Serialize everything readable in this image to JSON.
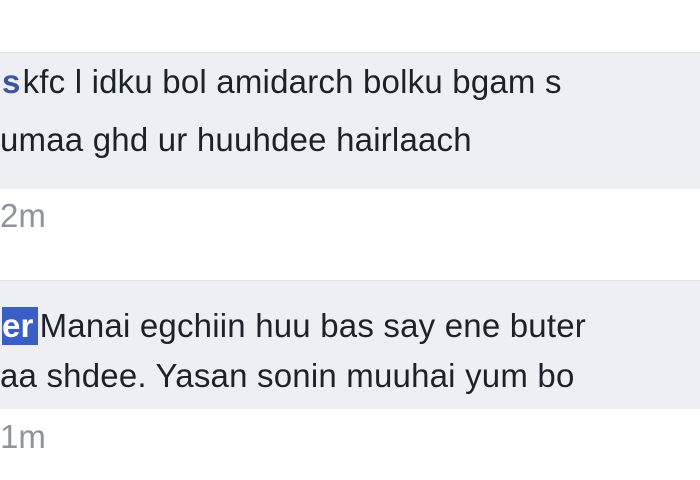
{
  "comments": [
    {
      "name_snippet": "s",
      "line1_rest": "kfc l idku bol amidarch bolku bgam s",
      "line2": "umaa ghd ur huuhdee hairlaach",
      "time": "2m"
    },
    {
      "name_snippet": "er",
      "line1_rest": "Manai egchiin huu bas say ene buter",
      "line2": "aa shdee. Yasan sonin muuhai yum bo",
      "time": "1m"
    }
  ],
  "colors": {
    "bubble_bg": "#edeff4",
    "text": "#1d2129",
    "meta": "#8e949d",
    "tag_bg": "#3b5ec6",
    "link": "#3b5998"
  }
}
